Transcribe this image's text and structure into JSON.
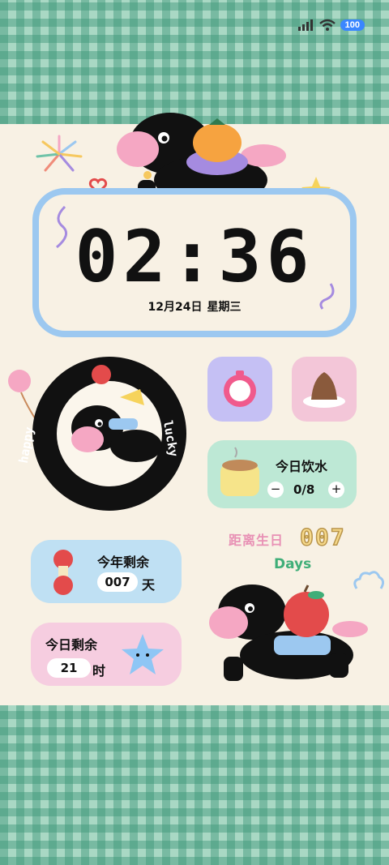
{
  "status": {
    "battery": "100",
    "signal_icon": "signal-bars-icon",
    "wifi_icon": "wifi-icon"
  },
  "clock": {
    "hours": "02",
    "minutes": "36",
    "date": "12月24日",
    "weekday": "星期三"
  },
  "badge": {
    "left_text": "happy",
    "right_text": "lucky"
  },
  "water": {
    "title": "今日饮水",
    "count": "0/8",
    "minus": "−",
    "plus": "+"
  },
  "birthday": {
    "label": "距离生日",
    "value": "007",
    "unit": "Days"
  },
  "year_remaining": {
    "title": "今年剩余",
    "value": "007",
    "unit": "天"
  },
  "day_remaining": {
    "title": "今日剩余",
    "value": "21",
    "unit": "时"
  },
  "colors": {
    "clock_frame": "#9cc8f0",
    "plaid": "#a9d8c4",
    "water_card": "#bde8d5",
    "year_card": "#bfe0f3",
    "day_card": "#f6cde0"
  }
}
